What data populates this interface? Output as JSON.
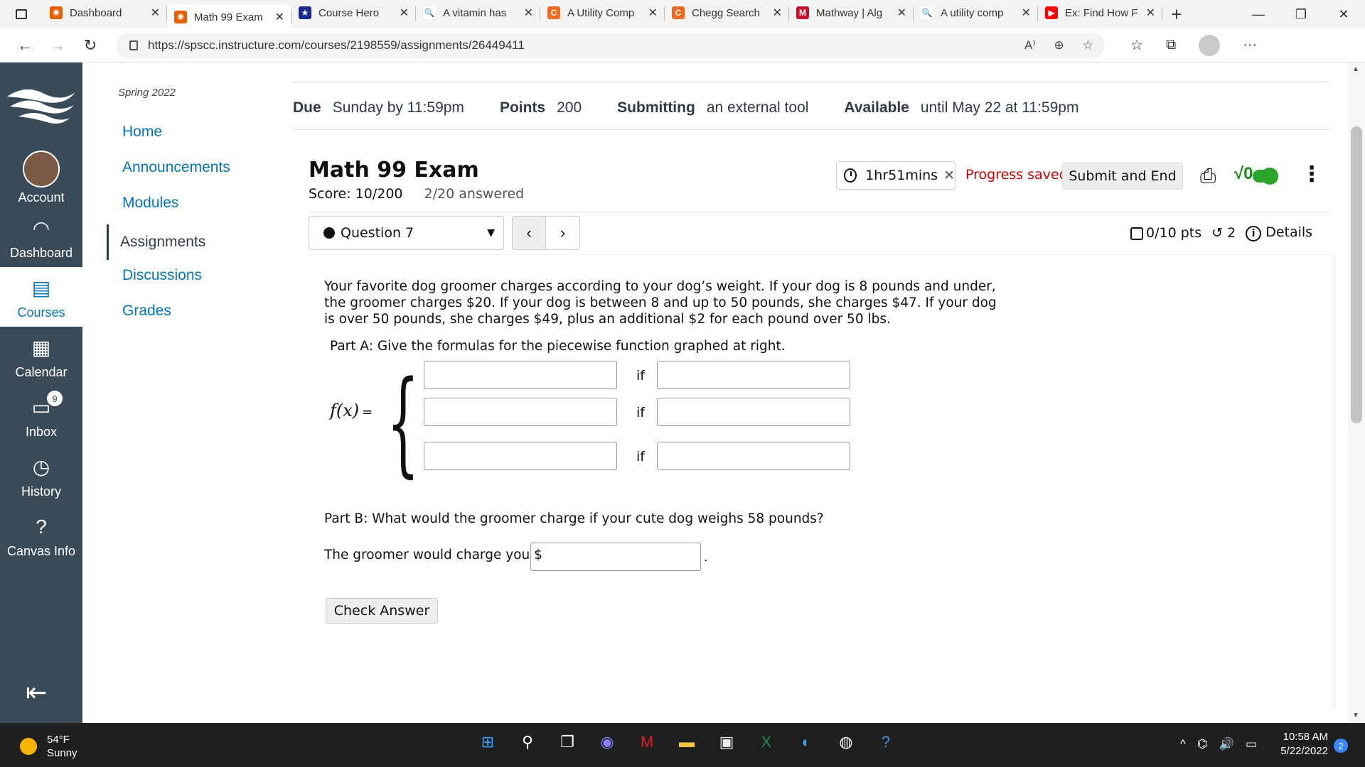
{
  "browser": {
    "tabs": [
      {
        "title": "Dashboard",
        "fav_color": "#e66000",
        "fav_glyph": "✺"
      },
      {
        "title": "Math 99 Exam",
        "fav_color": "#e66000",
        "fav_glyph": "✺",
        "active": true
      },
      {
        "title": "Course Hero",
        "fav_color": "#1a2a8c",
        "fav_glyph": "★"
      },
      {
        "title": "A vitamin has",
        "fav_color": "#ffffff",
        "fav_glyph": "🔍"
      },
      {
        "title": "A Utility Comp",
        "fav_color": "#f26a21",
        "fav_glyph": "C"
      },
      {
        "title": "Chegg Search",
        "fav_color": "#f26a21",
        "fav_glyph": "C"
      },
      {
        "title": "Mathway | Alg",
        "fav_color": "#c8102e",
        "fav_glyph": "M"
      },
      {
        "title": "A utility comp",
        "fav_color": "#ffffff",
        "fav_glyph": "🔍"
      },
      {
        "title": "Ex: Find How F",
        "fav_color": "#ff0000",
        "fav_glyph": "▶"
      }
    ],
    "url": "https://spscc.instructure.com/courses/2198559/assignments/26449411"
  },
  "global_nav": {
    "items": [
      {
        "label": "Account"
      },
      {
        "label": "Dashboard"
      },
      {
        "label": "Courses"
      },
      {
        "label": "Calendar"
      },
      {
        "label": "Inbox",
        "badge": "9"
      },
      {
        "label": "History"
      },
      {
        "label": "Canvas Info"
      }
    ]
  },
  "course_nav": {
    "term": "Spring 2022",
    "items": [
      "Home",
      "Announcements",
      "Modules",
      "Assignments",
      "Discussions",
      "Grades"
    ],
    "active": "Assignments"
  },
  "assignment": {
    "due_label": "Due",
    "due_value": "Sunday by 11:59pm",
    "points_label": "Points",
    "points_value": "200",
    "submitting_label": "Submitting",
    "submitting_value": "an external tool",
    "available_label": "Available",
    "available_value": "until May 22 at 11:59pm"
  },
  "quiz": {
    "title": "Math 99 Exam",
    "score": "Score: 10/200",
    "answered": "2/20 answered",
    "timer": "1hr51mins",
    "progress": "Progress saved",
    "submit_label": "Submit and End",
    "question_select": "Question 7",
    "pts": "0/10 pts",
    "attempts": "2",
    "details": "Details",
    "problem": "Your favorite dog groomer charges according to your dog’s weight. If your dog is 8 pounds and under, the groomer charges $20. If your dog is between 8 and up to 50 pounds, she charges $47. If your dog is over 50 pounds, she charges $49, plus an additional $2 for each pound over 50 lbs.",
    "part_a": "Part A: Give the formulas for the piecewise function graphed at right.",
    "fx_label": "f(x)",
    "if_label": "if",
    "part_b": "Part B: What would the groomer charge if your cute dog weighs 58 pounds?",
    "charge_prompt": "The groomer would charge you $",
    "check_label": "Check Answer"
  },
  "taskbar": {
    "temp": "54°F",
    "condition": "Sunny",
    "time": "10:58 AM",
    "date": "5/22/2022",
    "notif_count": "2"
  }
}
